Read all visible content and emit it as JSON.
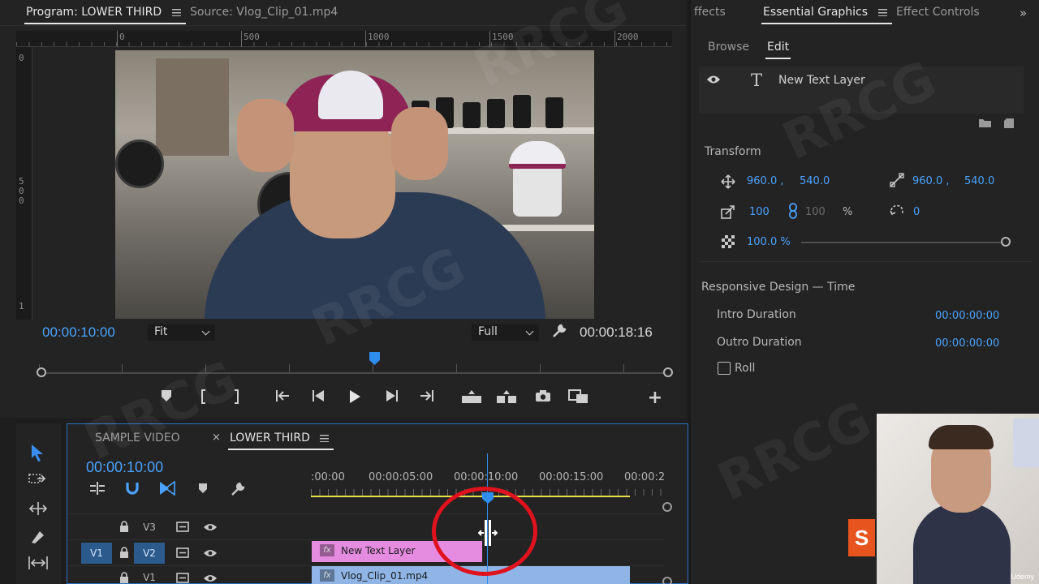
{
  "program_monitor": {
    "tab_label": "Program: LOWER THIRD",
    "source_tab": "Source: Vlog_Clip_01.mp4",
    "ruler_h": [
      "0",
      "500",
      "1000",
      "1500",
      "2000"
    ],
    "ruler_v_0": "0",
    "ruler_v_500": "5\n0\n0",
    "ruler_v_1": "1",
    "playhead_time": "00:00:10:00",
    "fit_label": "Fit",
    "resolution_label": "Full",
    "duration": "00:00:18:16"
  },
  "essential_graphics": {
    "effects_tab": "ffects",
    "tab_label": "Essential Graphics",
    "effect_controls_tab": "Effect Controls",
    "browse_tab": "Browse",
    "edit_tab": "Edit",
    "layer_name": "New Text Layer",
    "transform_heading": "Transform",
    "position_x": "960.0 ,",
    "position_y": "540.0",
    "anchor_x": "960.0 ,",
    "anchor_y": "540.0",
    "scale": "100",
    "scale_linked": "100",
    "scale_unit": "%",
    "rotation": "0",
    "opacity": "100.0 %",
    "opacity_level": 1.0,
    "responsive_heading": "Responsive Design — Time",
    "intro_label": "Intro Duration",
    "intro_value": "00:00:00:00",
    "outro_label": "Outro Duration",
    "outro_value": "00:00:00:00",
    "roll_label": "Roll"
  },
  "timeline": {
    "tab_sample": "SAMPLE VIDEO",
    "tab_lower": "LOWER THIRD",
    "timecode": "00:00:10:00",
    "ruler_labels": [
      ":00:00",
      "00:00:05:00",
      "00:00:10:00",
      "00:00:15:00",
      "00:00:2("
    ],
    "tracks": [
      "V3",
      "V2",
      "V1"
    ],
    "source_patch": "V1",
    "clip_text_layer": "New Text Layer",
    "clip_vlog": "Vlog_Clip_01.mp4"
  },
  "branding": {
    "udemy_letter": "S",
    "udemy_wordmark": "Udemy",
    "watermark": "RRCG"
  },
  "colors": {
    "accent_blue": "#4aa3ff",
    "clip_pink": "#e58ce0",
    "clip_blue": "#8fb5e6",
    "playhead_red_circle": "#e0121d"
  }
}
